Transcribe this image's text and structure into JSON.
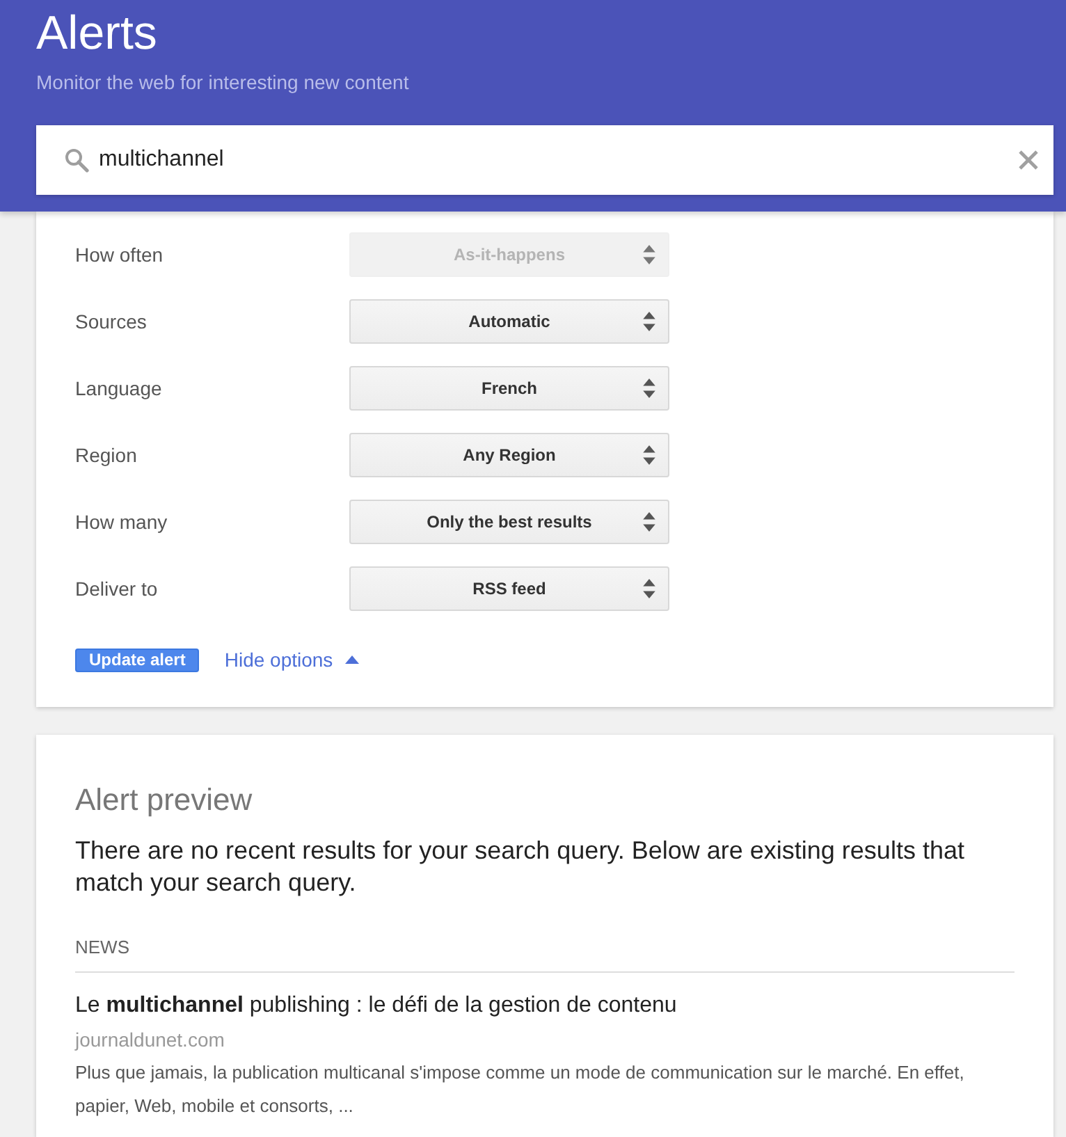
{
  "header": {
    "title": "Alerts",
    "subtitle": "Monitor the web for interesting new content"
  },
  "search": {
    "value": "multichannel"
  },
  "options": [
    {
      "label": "How often",
      "value": "As-it-happens",
      "disabled": true
    },
    {
      "label": "Sources",
      "value": "Automatic",
      "disabled": false
    },
    {
      "label": "Language",
      "value": "French",
      "disabled": false
    },
    {
      "label": "Region",
      "value": "Any Region",
      "disabled": false
    },
    {
      "label": "How many",
      "value": "Only the best results",
      "disabled": false
    },
    {
      "label": "Deliver to",
      "value": "RSS feed",
      "disabled": false
    }
  ],
  "actions": {
    "update_button": "Update alert",
    "toggle_link": "Hide options",
    "expanded": true
  },
  "preview": {
    "title": "Alert preview",
    "message": "There are no recent results for your search query. Below are existing results that match your search query.",
    "section": "NEWS",
    "results": [
      {
        "title": "Le **multichannel** publishing : le défi de la gestion de contenu",
        "source": "journaldunet.com",
        "snippet": "Plus que jamais, la publication multicanal s'impose comme un mode de communication sur le marché. En effet, papier, Web, mobile et consorts, ..."
      }
    ]
  }
}
